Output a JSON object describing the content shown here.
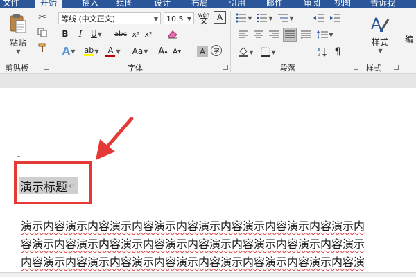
{
  "ribbon_tabs": [
    {
      "label": "文件"
    },
    {
      "label": "开始"
    },
    {
      "label": "插入"
    },
    {
      "label": "绘图"
    },
    {
      "label": "设计"
    },
    {
      "label": "布局"
    },
    {
      "label": "引用"
    },
    {
      "label": "邮件"
    },
    {
      "label": "审阅"
    },
    {
      "label": "视图"
    },
    {
      "label": "告诉我"
    }
  ],
  "clipboard": {
    "paste_label": "粘贴",
    "group_label": "剪贴板"
  },
  "font": {
    "family_value": "等线 (中文正文)",
    "size_value": "10.5",
    "group_label": "字体",
    "wen_label": "wén",
    "wen_char": "文",
    "border_char": "A",
    "circle_char": "字"
  },
  "paragraph": {
    "group_label": "段落"
  },
  "styles": {
    "label": "样式",
    "group_label": "样式",
    "edit_label": "编"
  },
  "colors": {
    "accent": "#2b579a",
    "highlight": "#ffff00",
    "font_red": "#c00000",
    "annotation_red": "#e53935",
    "selection": "#cfcfcf"
  },
  "document": {
    "title": "演示标题",
    "paragraph_mark": "↵",
    "body_lines": [
      "演示内容演示内容演示内容演示内容演示内容演示内容演示内容演示内",
      "容演示内容演示内容演示内容演示内容演示内容演示内容演示内容演示",
      "内容演示内容演示内容演示内容演示内容演示内容演示内容演示内容演"
    ]
  }
}
